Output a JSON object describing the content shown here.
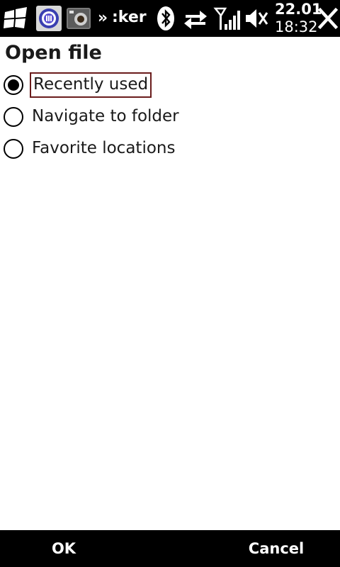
{
  "status_bar": {
    "overflow_symbol": "»",
    "app_title": ":ker",
    "clock_date": "22.01",
    "clock_time": "18:32",
    "icons": [
      "windows-start-icon",
      "app-icon",
      "camera-icon",
      "bluetooth-icon",
      "sync-arrows-icon",
      "signal-strength-icon",
      "volume-muted-icon",
      "close-icon"
    ]
  },
  "dialog": {
    "title": "Open file",
    "options": [
      {
        "label": "Recently used",
        "selected": true
      },
      {
        "label": "Navigate to folder",
        "selected": false
      },
      {
        "label": "Favorite locations",
        "selected": false
      }
    ]
  },
  "softkeys": {
    "left": "OK",
    "right": "Cancel"
  },
  "colors": {
    "bar_background": "#000000",
    "page_background": "#ffffff",
    "focus_border": "#6a1c1c",
    "text": "#1a1a1a"
  }
}
